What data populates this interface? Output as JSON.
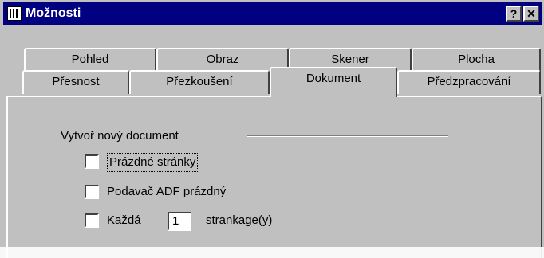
{
  "window": {
    "title": "Možnosti",
    "help_label": "?",
    "close_label": "✕"
  },
  "tabs_row1": [
    "Pohled",
    "Obraz",
    "Skener",
    "Plocha"
  ],
  "tabs_row2": [
    "Přesnost",
    "Přezkoušení",
    "Dokument",
    "Předzpracování"
  ],
  "active_tab": "Dokument",
  "group": {
    "label": "Vytvoř nový document"
  },
  "options": {
    "blank_pages": {
      "label": "Prázdné stránky",
      "checked": false
    },
    "adf_empty": {
      "label": "Podavač ADF prázdný",
      "checked": false
    },
    "every": {
      "label": "Každá",
      "value": "1",
      "suffix": "strankage(y)",
      "checked": false
    }
  },
  "icons": {
    "app": "app-window-icon",
    "help": "help-icon",
    "close": "close-icon"
  }
}
